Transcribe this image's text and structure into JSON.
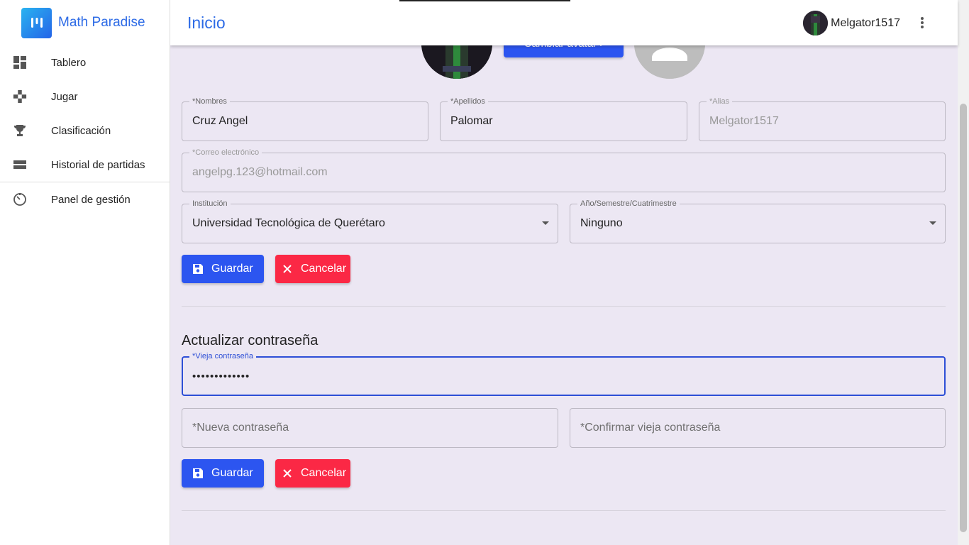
{
  "app": {
    "name": "Math Paradise"
  },
  "sidebar": {
    "items": [
      {
        "label": "Tablero",
        "icon": "dashboard-icon"
      },
      {
        "label": "Jugar",
        "icon": "gamepad-icon"
      },
      {
        "label": "Clasificación",
        "icon": "trophy-icon"
      },
      {
        "label": "Historial de partidas",
        "icon": "history-list-icon"
      },
      {
        "label": "Panel de gestión",
        "icon": "timer-icon"
      }
    ]
  },
  "header": {
    "title": "Inicio",
    "username": "Melgator1517"
  },
  "avatar": {
    "change_label": "Cambiar avatar"
  },
  "profile_form": {
    "nombres": {
      "label": "*Nombres",
      "value": "Cruz Angel"
    },
    "apellidos": {
      "label": "*Apellidos",
      "value": "Palomar"
    },
    "alias": {
      "label": "*Alias",
      "value": "Melgator1517"
    },
    "correo": {
      "label": "*Correo electrónico",
      "value": "angelpg.123@hotmail.com"
    },
    "institucion": {
      "label": "Institución",
      "value": "Universidad Tecnológica de Querétaro"
    },
    "anio": {
      "label": "Año/Semestre/Cuatrimestre",
      "value": "Ninguno"
    },
    "save_label": "Guardar",
    "cancel_label": "Cancelar"
  },
  "password_form": {
    "title": "Actualizar contraseña",
    "old": {
      "label": "*Vieja contraseña",
      "value": "•••••••••••••"
    },
    "new": {
      "placeholder": "*Nueva contraseña"
    },
    "confirm": {
      "placeholder": "*Confirmar vieja contraseña"
    },
    "save_label": "Guardar",
    "cancel_label": "Cancelar"
  },
  "colors": {
    "primary": "#2c55f0",
    "danger": "#fb2845",
    "brand": "#2d6be6",
    "background": "#ece7f3"
  }
}
